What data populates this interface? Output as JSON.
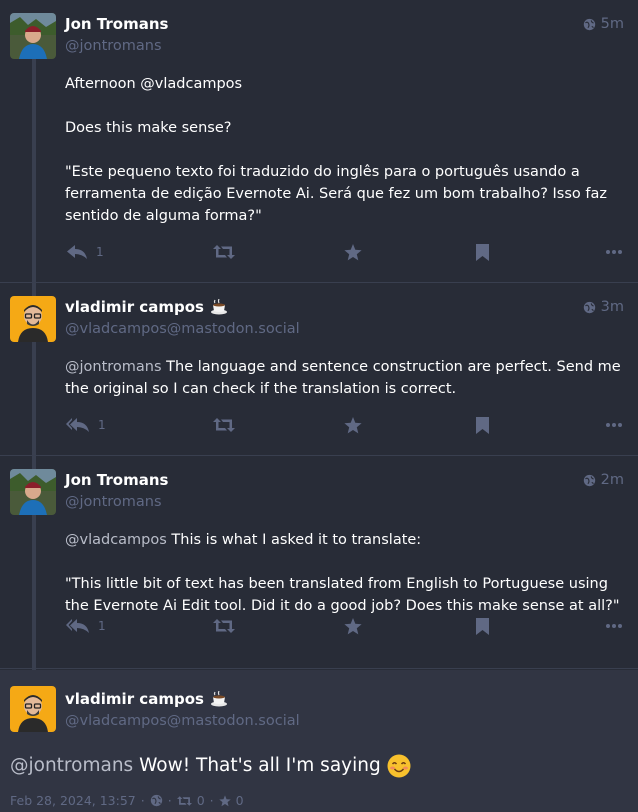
{
  "statuses": [
    {
      "display_name": "Jon Tromans",
      "acct": "@jontromans",
      "time": "5m",
      "paragraphs": [
        {
          "mention": "",
          "text": "Afternoon @vladcampos"
        },
        {
          "mention": "",
          "text": "Does this make sense?"
        },
        {
          "mention": "",
          "text": "\"Este pequeno texto foi traduzido do inglês para o português usando a ferramenta de edição Evernote Ai. Será que fez um bom trabalho? Isso faz sentido de alguma forma?\""
        }
      ],
      "reply_count": "1"
    },
    {
      "display_name": "vladimir campos",
      "acct": "@vladcampos@mastodon.social",
      "time": "3m",
      "paragraphs": [
        {
          "mention": "@jontromans",
          "text": " The language and sentence construction are perfect. Send me the original so I can check if the translation is correct."
        }
      ],
      "reply_count": "1"
    },
    {
      "display_name": "Jon Tromans",
      "acct": "@jontromans",
      "time": "2m",
      "paragraphs": [
        {
          "mention": "@vladcampos",
          "text": " This is what I asked it to translate:"
        },
        {
          "mention": "",
          "text": "\"This little bit of text has been translated from English to Portuguese using the Evernote Ai Edit tool. Did it do a good job? Does this make sense at all?\""
        }
      ],
      "reply_count": "1"
    }
  ],
  "focused": {
    "display_name": "vladimir campos",
    "acct": "@vladcampos@mastodon.social",
    "mention": "@jontromans",
    "text": " Wow! That's all I'm saying",
    "date": "Feb 28, 2024, 13:57",
    "sep": "·",
    "boosts": "0",
    "favourites": "0"
  },
  "icons": {
    "visibility": "globe-icon",
    "reply": "reply-icon",
    "reply_all": "reply-all-icon",
    "boost": "retweet-icon",
    "favourite": "star-icon",
    "bookmark": "bookmark-icon",
    "more": "ellipsis-icon",
    "name_emoji": "coffee-icon",
    "content_emoji": "smiling-face-icon"
  },
  "colors": {
    "background": "#282c37",
    "focused_background": "#313543",
    "muted": "#606984",
    "text": "#ffffff"
  }
}
